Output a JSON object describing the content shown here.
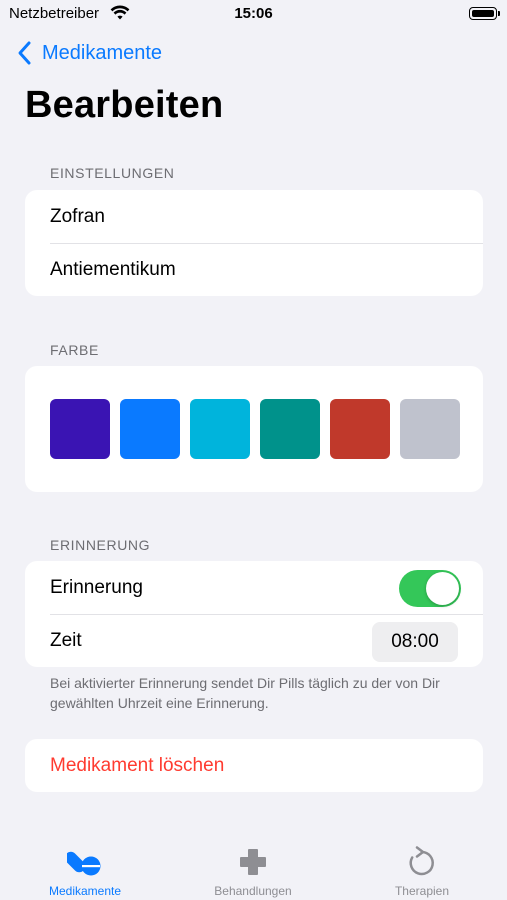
{
  "status_bar": {
    "carrier": "Netzbetreiber",
    "time": "15:06"
  },
  "nav": {
    "back_label": "Medikamente"
  },
  "title": "Bearbeiten",
  "sections": {
    "settings": {
      "header": "EINSTELLUNGEN",
      "rows": [
        "Zofran",
        "Antiementikum"
      ]
    },
    "color": {
      "header": "FARBE",
      "swatches": [
        "#3a14b3",
        "#0a7aff",
        "#00b4dc",
        "#00928b",
        "#c0392b",
        "#bfc2cd"
      ]
    },
    "reminder": {
      "header": "ERINNERUNG",
      "toggle_label": "Erinnerung",
      "toggle_on": true,
      "time_label": "Zeit",
      "time_value": "08:00",
      "footnote": "Bei aktivierter Erinnerung sendet Dir Pills täglich zu der von Dir gewählten Uhrzeit eine Erinnerung."
    },
    "delete": {
      "label": "Medikament löschen"
    }
  },
  "tabs": [
    {
      "label": "Medikamente",
      "icon": "pills-icon",
      "active": true
    },
    {
      "label": "Behandlungen",
      "icon": "medical-cross-icon",
      "active": false
    },
    {
      "label": "Therapien",
      "icon": "refresh-icon",
      "active": false
    }
  ],
  "colors": {
    "accent": "#0a7aff",
    "destructive": "#ff3b30",
    "toggle_on": "#34c759"
  }
}
